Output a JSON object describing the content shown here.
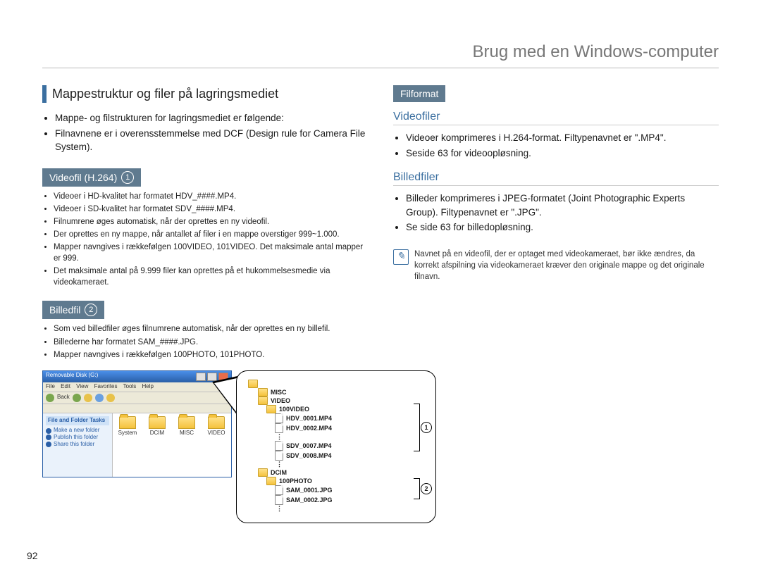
{
  "pageTitle": "Brug med en Windows-computer",
  "pageNumber": "92",
  "left": {
    "heading": "Mappestruktur og filer på lagringsmediet",
    "intro": [
      "Mappe- og filstrukturen for lagringsmediet er følgende:",
      "Filnavnene er i overensstemmelse med DCF (Design rule for Camera File System)."
    ],
    "videoPill": "Videofil (H.264)",
    "videoPillNum": "1",
    "videoList": [
      "Videoer i HD-kvalitet har formatet HDV_####.MP4.",
      "Videoer i SD-kvalitet har formatet SDV_####.MP4.",
      "Filnumrene øges automatisk, når der oprettes en ny videofil.",
      "Der oprettes en ny mappe, når antallet af filer i en mappe overstiger 999~1.000.",
      "Mapper navngives i rækkefølgen 100VIDEO, 101VIDEO. Det maksimale antal mapper er 999.",
      "Det maksimale antal på 9.999 filer kan oprettes på et hukommelsesmedie via videokameraet."
    ],
    "photoPill": "Billedfil",
    "photoPillNum": "2",
    "photoList": [
      "Som ved billedfiler øges filnumrene automatisk, når der oprettes en ny billefil.",
      "Billederne har formatet SAM_####.JPG.",
      "Mapper navngives i rækkefølgen 100PHOTO, 101PHOTO."
    ]
  },
  "right": {
    "formatPill": "Filformat",
    "videoHeading": "Videofiler",
    "videoList": [
      "Videoer komprimeres i H.264-format. Filtypenavnet er \".MP4\".",
      "Seside 63 for videoopløsning."
    ],
    "imageHeading": "Billedfiler",
    "imageList": [
      "Billeder komprimeres i JPEG-formatet (Joint Photographic Experts Group). Filtypenavnet er \".JPG\".",
      "Se side 63 for billedopløsning."
    ],
    "note": "Navnet på en videofil, der er optaget med videokameraet, bør ikke ændres, da korrekt afspilning via videokameraet kræver den originale mappe og det originale filnavn."
  },
  "explorer": {
    "title": "Removable Disk (G:)",
    "menu": [
      "File",
      "Edit",
      "View",
      "Favorites",
      "Tools",
      "Help"
    ],
    "toolbarBack": "Back",
    "sidePanelTitle": "File and Folder Tasks",
    "sideLinks": [
      "Make a new folder",
      "Publish this folder",
      "Share this folder"
    ],
    "folders": [
      "System",
      "DCIM",
      "MISC",
      "VIDEO"
    ]
  },
  "tree": {
    "root": "",
    "n_misc": "MISC",
    "n_video": "VIDEO",
    "n_100video": "100VIDEO",
    "f_hdv1": "HDV_0001.MP4",
    "f_hdv2": "HDV_0002.MP4",
    "f_sdv7": "SDV_0007.MP4",
    "f_sdv8": "SDV_0008.MP4",
    "n_dcim": "DCIM",
    "n_100photo": "100PHOTO",
    "f_sam1": "SAM_0001.JPG",
    "f_sam2": "SAM_0002.JPG",
    "b1": "1",
    "b2": "2"
  }
}
